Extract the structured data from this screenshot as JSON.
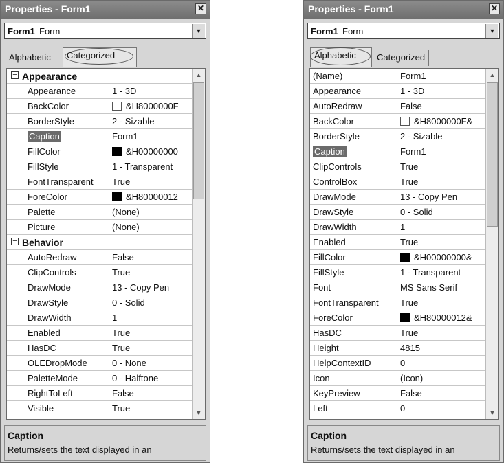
{
  "left_window": {
    "title": "Properties - Form1",
    "close_glyph": "✕",
    "object_name": "Form1",
    "object_type": "Form",
    "tabs": [
      "Alphabetic",
      "Categorized"
    ],
    "active_tab": "Categorized",
    "rows": [
      {
        "type": "category",
        "name": "Appearance",
        "expander": "⊟"
      },
      {
        "name": "Appearance",
        "value": "1 - 3D"
      },
      {
        "name": "BackColor",
        "value": "&H8000000F",
        "swatch": "white"
      },
      {
        "name": "BorderStyle",
        "value": "2 - Sizable"
      },
      {
        "name": "Caption",
        "value": "Form1",
        "selected": true
      },
      {
        "name": "FillColor",
        "value": "&H00000000",
        "swatch": "black"
      },
      {
        "name": "FillStyle",
        "value": "1 - Transparent"
      },
      {
        "name": "FontTransparent",
        "value": "True"
      },
      {
        "name": "ForeColor",
        "value": "&H80000012",
        "swatch": "black"
      },
      {
        "name": "Palette",
        "value": "(None)"
      },
      {
        "name": "Picture",
        "value": "(None)"
      },
      {
        "type": "category",
        "name": "Behavior",
        "expander": "⊟"
      },
      {
        "name": "AutoRedraw",
        "value": "False"
      },
      {
        "name": "ClipControls",
        "value": "True"
      },
      {
        "name": "DrawMode",
        "value": "13 - Copy Pen"
      },
      {
        "name": "DrawStyle",
        "value": "0 - Solid"
      },
      {
        "name": "DrawWidth",
        "value": "1"
      },
      {
        "name": "Enabled",
        "value": "True"
      },
      {
        "name": "HasDC",
        "value": "True"
      },
      {
        "name": "OLEDropMode",
        "value": "0 - None"
      },
      {
        "name": "PaletteMode",
        "value": "0 - Halftone"
      },
      {
        "name": "RightToLeft",
        "value": "False"
      },
      {
        "name": "Visible",
        "value": "True"
      }
    ],
    "description_title": "Caption",
    "description_text": "Returns/sets the text displayed in an"
  },
  "right_window": {
    "title": "Properties - Form1",
    "close_glyph": "✕",
    "object_name": "Form1",
    "object_type": "Form",
    "tabs": [
      "Alphabetic",
      "Categorized"
    ],
    "active_tab": "Alphabetic",
    "rows": [
      {
        "name": "(Name)",
        "value": "Form1"
      },
      {
        "name": "Appearance",
        "value": "1 - 3D"
      },
      {
        "name": "AutoRedraw",
        "value": "False"
      },
      {
        "name": "BackColor",
        "value": "&H8000000F&",
        "swatch": "white"
      },
      {
        "name": "BorderStyle",
        "value": "2 - Sizable"
      },
      {
        "name": "Caption",
        "value": "Form1",
        "selected": true
      },
      {
        "name": "ClipControls",
        "value": "True"
      },
      {
        "name": "ControlBox",
        "value": "True"
      },
      {
        "name": "DrawMode",
        "value": "13 - Copy Pen"
      },
      {
        "name": "DrawStyle",
        "value": "0 - Solid"
      },
      {
        "name": "DrawWidth",
        "value": "1"
      },
      {
        "name": "Enabled",
        "value": "True"
      },
      {
        "name": "FillColor",
        "value": "&H00000000&",
        "swatch": "black"
      },
      {
        "name": "FillStyle",
        "value": "1 - Transparent"
      },
      {
        "name": "Font",
        "value": "MS Sans Serif"
      },
      {
        "name": "FontTransparent",
        "value": "True"
      },
      {
        "name": "ForeColor",
        "value": "&H80000012&",
        "swatch": "black"
      },
      {
        "name": "HasDC",
        "value": "True"
      },
      {
        "name": "Height",
        "value": "4815"
      },
      {
        "name": "HelpContextID",
        "value": "0"
      },
      {
        "name": "Icon",
        "value": "(Icon)"
      },
      {
        "name": "KeyPreview",
        "value": "False"
      },
      {
        "name": "Left",
        "value": "0"
      }
    ],
    "description_title": "Caption",
    "description_text": "Returns/sets the text displayed in an"
  },
  "icons": {
    "close": "close-icon",
    "dropdown": "chevron-down-icon",
    "scroll_up": "scroll-up-icon",
    "scroll_down": "scroll-down-icon",
    "expander": "collapse-icon"
  }
}
